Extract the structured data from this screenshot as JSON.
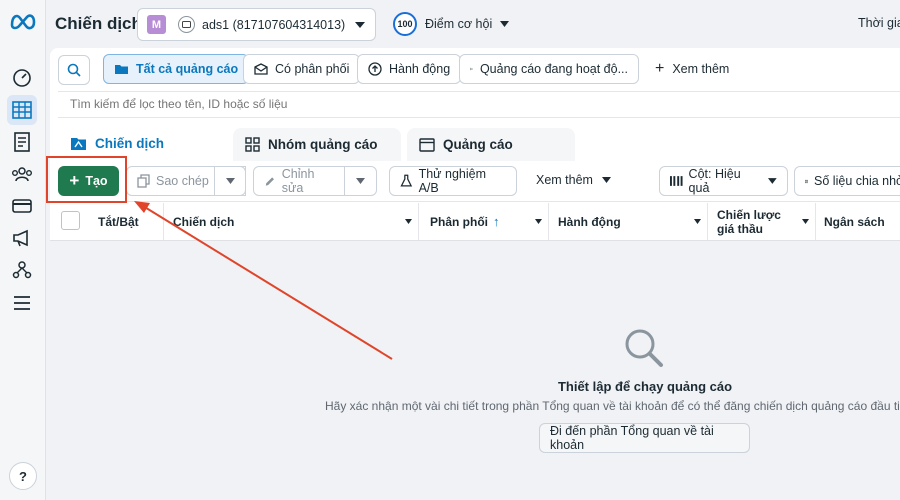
{
  "header": {
    "page_title": "Chiến dịch",
    "account_badge": "M",
    "account_name": "ads1 (817107604314013)",
    "score_value": "100",
    "score_label": "Điểm cơ hội",
    "right_cut_text": "Thời gia"
  },
  "filters": {
    "all_ads": "Tất cả quảng cáo",
    "with_delivery": "Có phân phối",
    "actions": "Hành động",
    "active_ads": "Quảng cáo đang hoạt độ...",
    "see_more": "Xem thêm",
    "search_placeholder": "Tìm kiếm để lọc theo tên, ID hoặc số liệu"
  },
  "tabs": [
    {
      "label": "Chiến dịch"
    },
    {
      "label": "Nhóm quảng cáo"
    },
    {
      "label": "Quảng cáo"
    }
  ],
  "toolbar": {
    "create": "Tạo",
    "duplicate": "Sao chép",
    "edit": "Chỉnh sửa",
    "ab_test": "Thử nghiệm A/B",
    "more": "Xem thêm",
    "columns": "Cột: Hiệu quả",
    "breakdown": "Số liệu chia nhỏ"
  },
  "table": {
    "headers": [
      "Tắt/Bật",
      "Chiến dịch",
      "Phân phối",
      "Hành động",
      "Chiến lược giá thầu",
      "Ngân sách"
    ]
  },
  "empty_state": {
    "title": "Thiết lập để chạy quảng cáo",
    "message": "Hãy xác nhận một vài chi tiết trong phần Tổng quan về tài khoản để có thể đăng chiến dịch quảng cáo đầu tiên c",
    "button": "Đi đến phần Tổng quan về tài khoản"
  },
  "colors": {
    "primary_green": "#1f7a4f",
    "accent_blue": "#0a78be",
    "annotation_red": "#e0452b"
  },
  "help": "?"
}
